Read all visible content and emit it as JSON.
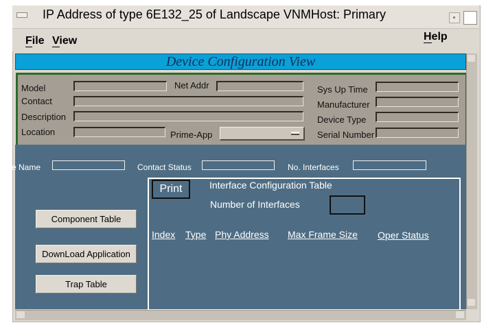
{
  "window": {
    "title": "IP Address of type 6E132_25 of  Landscape VNMHost: Primary"
  },
  "menu": {
    "file": "File",
    "view": "View",
    "help": "Help"
  },
  "banner": "Device Configuration View",
  "device": {
    "model_label": "Model",
    "net_addr_label": "Net Addr",
    "sys_up_time_label": "Sys Up Time",
    "contact_label": "Contact",
    "manufacturer_label": "Manufacturer",
    "description_label": "Description",
    "device_type_label": "Device Type",
    "location_label": "Location",
    "prime_app_label": "Prime-App",
    "serial_number_label": "Serial Number"
  },
  "summary": {
    "name_label": "e Name",
    "contact_status_label": "Contact Status",
    "num_interfaces_label": "No. Interfaces"
  },
  "actions": {
    "component_table": "Component Table",
    "download_application": "DownLoad Application",
    "trap_table": "Trap Table"
  },
  "interfaces": {
    "print": "Print",
    "table_title": "Interface Configuration Table",
    "number_label": "Number of Interfaces",
    "columns": [
      "Index",
      "Type",
      "Phy Address",
      "Max Frame Size",
      "Oper Status"
    ]
  },
  "colors": {
    "banner": "#0aa0d8",
    "panel_bg": "#a59e94",
    "panel_border": "#2b6b2b",
    "work_area": "#4e6d84"
  }
}
